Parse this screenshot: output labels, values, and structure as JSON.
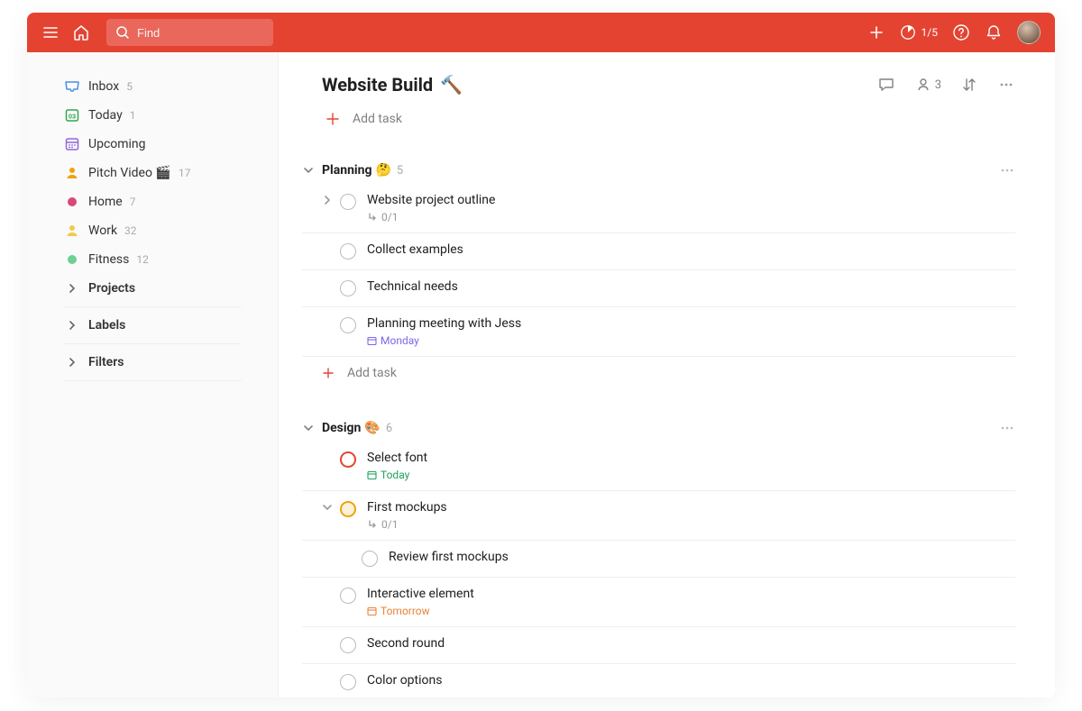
{
  "topbar": {
    "search_placeholder": "Find",
    "productivity_counter": "1/5"
  },
  "sidebar": {
    "nav": [
      {
        "key": "inbox",
        "label": "Inbox",
        "count": "5",
        "icon": "inbox",
        "color": "#4a90e2"
      },
      {
        "key": "today",
        "label": "Today",
        "count": "1",
        "icon": "today",
        "color": "#2fa84f"
      },
      {
        "key": "upcoming",
        "label": "Upcoming",
        "count": "",
        "icon": "upcoming",
        "color": "#8e67d9"
      }
    ],
    "favorites": [
      {
        "key": "pitch",
        "label": "Pitch Video 🎬",
        "count": "17",
        "icon": "person",
        "color": "#f0a30a"
      },
      {
        "key": "home",
        "label": "Home",
        "count": "7",
        "icon": "dot",
        "color": "#d9487b"
      },
      {
        "key": "work",
        "label": "Work",
        "count": "32",
        "icon": "person",
        "color": "#f2c94c"
      },
      {
        "key": "fitness",
        "label": "Fitness",
        "count": "12",
        "icon": "dot",
        "color": "#6fcf97"
      }
    ],
    "sections": [
      {
        "key": "projects",
        "label": "Projects"
      },
      {
        "key": "labels",
        "label": "Labels"
      },
      {
        "key": "filters",
        "label": "Filters"
      }
    ]
  },
  "project": {
    "title": "Website Build",
    "title_emoji": "🔨",
    "add_task_label": "Add task",
    "share_count": "3",
    "sections": [
      {
        "name": "Planning",
        "emoji": "🤔",
        "count": "5",
        "tasks": [
          {
            "title": "Website project outline",
            "priority": "",
            "expandable": true,
            "sub_meta": "0/1",
            "due": ""
          },
          {
            "title": "Collect examples",
            "priority": "",
            "expandable": false,
            "sub_meta": "",
            "due": ""
          },
          {
            "title": "Technical needs",
            "priority": "",
            "expandable": false,
            "sub_meta": "",
            "due": ""
          },
          {
            "title": "Planning meeting with Jess",
            "priority": "",
            "expandable": false,
            "sub_meta": "",
            "due": "Monday",
            "due_color": "purple"
          }
        ],
        "add_task": "Add task"
      },
      {
        "name": "Design",
        "emoji": "🎨",
        "count": "6",
        "tasks": [
          {
            "title": "Select font",
            "priority": "p1",
            "expandable": false,
            "sub_meta": "",
            "due": "Today",
            "due_color": "green"
          },
          {
            "title": "First mockups",
            "priority": "p2",
            "expandable": true,
            "expanded": true,
            "sub_meta": "0/1",
            "due": "",
            "subtasks": [
              {
                "title": "Review first mockups"
              }
            ]
          },
          {
            "title": "Interactive element",
            "priority": "",
            "expandable": false,
            "sub_meta": "",
            "due": "Tomorrow",
            "due_color": "orange"
          },
          {
            "title": "Second round",
            "priority": "",
            "expandable": false,
            "sub_meta": "",
            "due": ""
          },
          {
            "title": "Color options",
            "priority": "",
            "expandable": false,
            "sub_meta": "",
            "due": ""
          }
        ]
      }
    ]
  }
}
